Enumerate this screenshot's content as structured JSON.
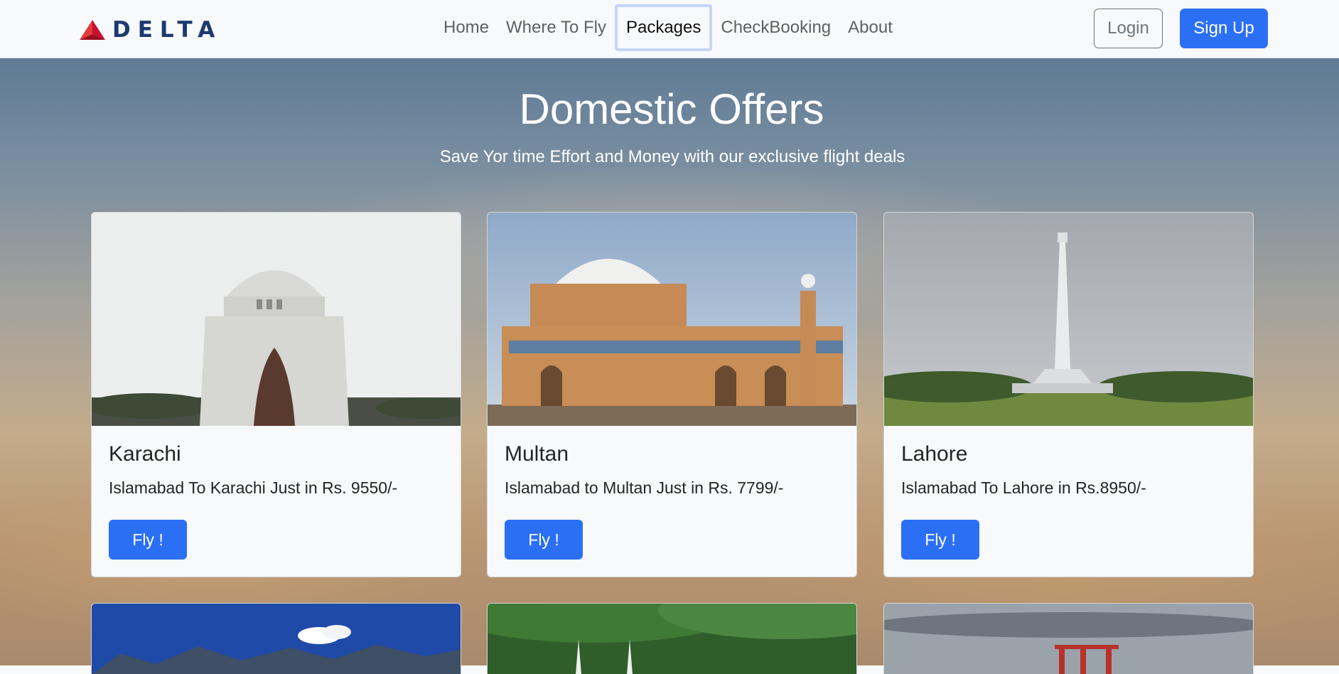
{
  "nav": {
    "brand": "DELTA",
    "links": [
      "Home",
      "Where To Fly",
      "Packages",
      "CheckBooking",
      "About"
    ],
    "active": "Packages",
    "login": "Login",
    "signup": "Sign Up"
  },
  "hero": {
    "title": "Domestic Offers",
    "subtitle": "Save Yor time Effort and Money with our exclusive flight deals"
  },
  "cards": [
    {
      "city": "Karachi",
      "text": "Islamabad To Karachi Just in Rs. 9550/-",
      "button": "Fly !"
    },
    {
      "city": "Multan",
      "text": "Islamabad to Multan Just in Rs. 7799/-",
      "button": "Fly !"
    },
    {
      "city": "Lahore",
      "text": "Islamabad To Lahore in Rs.8950/-",
      "button": "Fly !"
    }
  ],
  "colors": {
    "primary": "#2b6ff5",
    "brand_red": "#c8102e",
    "brand_navy": "#1c3a70",
    "navbar_bg": "#f8f9fa"
  }
}
